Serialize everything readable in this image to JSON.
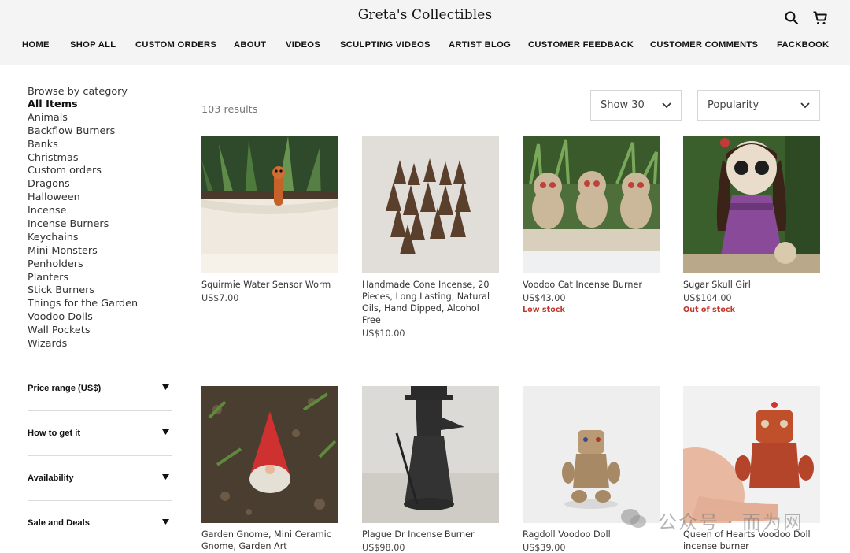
{
  "header": {
    "brand": "Greta's Collectibles",
    "icons": {
      "search": "search-icon",
      "cart": "cart-icon"
    },
    "nav": [
      "HOME",
      "SHOP ALL",
      "CUSTOM ORDERS",
      "ABOUT",
      "VIDEOS",
      "SCULPTING VIDEOS",
      "ARTIST BLOG",
      "CUSTOMER FEEDBACK",
      "CUSTOMER COMMENTS",
      "FACKBOOK"
    ]
  },
  "sidebar": {
    "heading": "Browse by category",
    "categories": [
      "All Items",
      "Animals",
      "Backflow Burners",
      "Banks",
      "Christmas",
      "Custom orders",
      "Dragons",
      "Halloween",
      "Incense",
      "Incense Burners",
      "Keychains",
      "Mini Monsters",
      "Penholders",
      "Planters",
      "Stick Burners",
      "Things for the Garden",
      "Voodoo Dolls",
      "Wall Pockets",
      "Wizards"
    ],
    "active_category": "All Items",
    "filters": [
      "Price range (US$)",
      "How to get it",
      "Availability",
      "Sale and Deals"
    ]
  },
  "toolbar": {
    "results": "103 results",
    "show": "Show 30",
    "sort": "Popularity"
  },
  "products": [
    {
      "title": "Squirmie Water Sensor Worm",
      "price": "US$7.00",
      "badge": ""
    },
    {
      "title": "Handmade Cone Incense, 20 Pieces, Long Lasting, Natural Oils, Hand Dipped, Alcohol Free",
      "price": "US$10.00",
      "badge": ""
    },
    {
      "title": "Voodoo Cat Incense Burner",
      "price": "US$43.00",
      "badge": "Low stock"
    },
    {
      "title": "Sugar Skull Girl",
      "price": "US$104.00",
      "badge": "Out of stock"
    },
    {
      "title": "Garden Gnome, Mini Ceramic Gnome, Garden Art",
      "price": "",
      "badge": ""
    },
    {
      "title": "Plague Dr Incense Burner",
      "price": "US$98.00",
      "badge": ""
    },
    {
      "title": "Ragdoll Voodoo Doll",
      "price": "US$39.00",
      "badge": ""
    },
    {
      "title": "Queen of Hearts Voodoo Doll incense burner",
      "price": "",
      "badge": ""
    }
  ],
  "watermark": "公众号 · 而为网",
  "colors": {
    "header_bg": "#f4f4f4",
    "badge": "#c0392b",
    "muted": "#777777"
  }
}
